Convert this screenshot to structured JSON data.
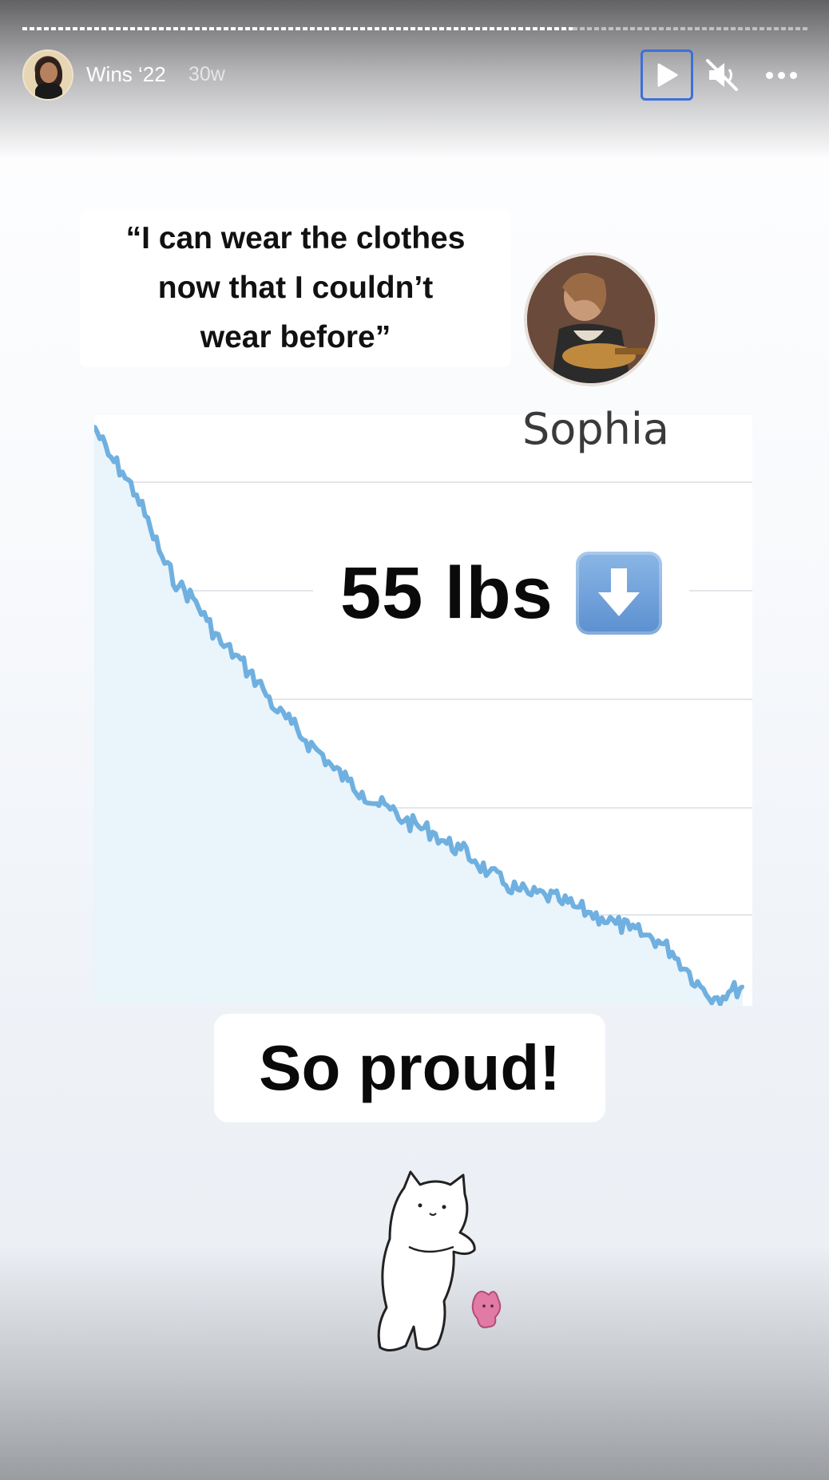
{
  "story": {
    "title": "Wins ‘22",
    "age": "30w",
    "progress_fraction": 0.7
  },
  "controls": {
    "play_icon": "play-icon",
    "mute_icon": "speaker-muted-icon",
    "more_icon": "more-dots-icon"
  },
  "content": {
    "quote_line1": "“I can wear the clothes",
    "quote_line2": "now that I couldn’t",
    "quote_line3": "wear before”",
    "person_name": "Sophia",
    "weight_loss": "55 lbs",
    "weight_loss_icon": "down-arrow-emoji-icon",
    "caption": "So proud!"
  },
  "colors": {
    "accent_focus": "#3d6fd8",
    "line": "#6fb0e0",
    "arrow_emoji": "#5b8fcf"
  },
  "chart_data": {
    "type": "line",
    "title": "",
    "xlabel": "",
    "ylabel": "",
    "grid": true,
    "series": [
      {
        "values": [
          100,
          95,
          92,
          88,
          82,
          76,
          72,
          70,
          66,
          62,
          60,
          57,
          54,
          50,
          48,
          45,
          43,
          40,
          38,
          36,
          34,
          33,
          31,
          30,
          29,
          27,
          26,
          24,
          22,
          20,
          19,
          18,
          18,
          17,
          16,
          15,
          14,
          13,
          12,
          11,
          10,
          8,
          5,
          2,
          0,
          1,
          2
        ]
      }
    ]
  }
}
